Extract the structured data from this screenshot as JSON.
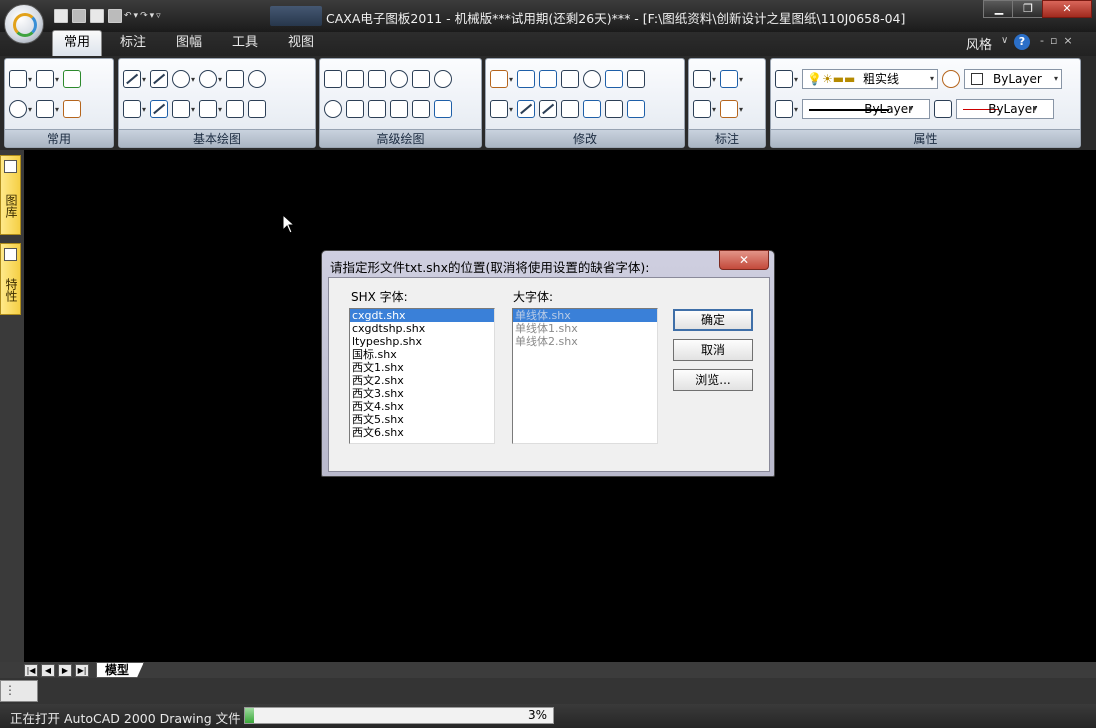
{
  "window": {
    "title": "CAXA电子图板2011 - 机械版***试用期(还剩26天)*** - [F:\\图纸资料\\创新设计之星图纸\\110J0658-04]",
    "minimize_icon": "minimize-icon",
    "maximize_icon": "maximize-icon",
    "close_icon": "close-icon"
  },
  "ribbon": {
    "tabs": [
      {
        "label": "常用"
      },
      {
        "label": "标注"
      },
      {
        "label": "图幅"
      },
      {
        "label": "工具"
      },
      {
        "label": "视图"
      }
    ],
    "style_label": "风格",
    "panels": {
      "changyong": "常用",
      "jiben": "基本绘图",
      "gaoji": "高级绘图",
      "xiugai": "修改",
      "biaozhu": "标注",
      "shuxing": "属性"
    },
    "properties": {
      "linetype_label": "粗实线",
      "color_value": "ByLayer",
      "linetype_value": "ByLayer",
      "lineweight_value": "ByLayer"
    }
  },
  "left_dock": {
    "tabs": [
      {
        "label": "图库"
      },
      {
        "label": "特性"
      }
    ]
  },
  "bottom": {
    "model_tab": "模型",
    "status_text": "正在打开 AutoCAD 2000 Drawing 文件",
    "progress_text": "3%",
    "progress_value": 0.03
  },
  "dialog": {
    "title": "请指定形文件txt.shx的位置(取消将使用设置的缺省字体):",
    "close_label": "✕",
    "shx_label": "SHX 字体:",
    "big_label": "大字体:",
    "shx_fonts": [
      "cxgdt.shx",
      "cxgdtshp.shx",
      "ltypeshp.shx",
      "国标.shx",
      "西文1.shx",
      "西文2.shx",
      "西文3.shx",
      "西文4.shx",
      "西文5.shx",
      "西文6.shx"
    ],
    "big_fonts": [
      "单线体.shx",
      "单线体1.shx",
      "单线体2.shx"
    ],
    "ok_label": "确定",
    "cancel_label": "取消",
    "browse_label": "浏览..."
  },
  "colors": {
    "canvas": "#000000",
    "selection": "#3a80d8",
    "dock_tab": "#f5cf45"
  }
}
